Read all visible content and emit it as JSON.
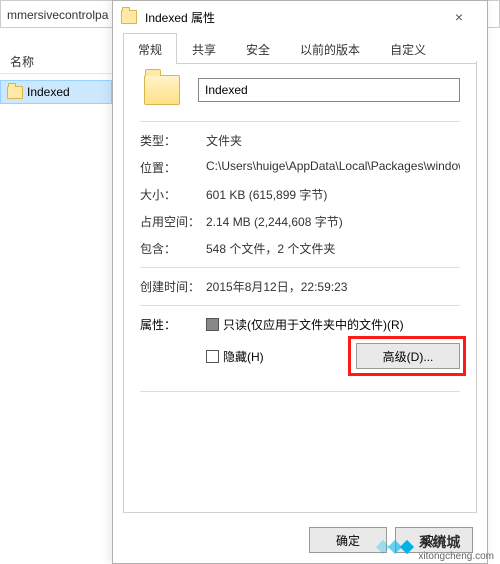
{
  "explorer": {
    "path": "mmersivecontrolpa",
    "column_name": "名称",
    "selected_item": "Indexed"
  },
  "dialog": {
    "title": "Indexed 属性",
    "close": "×",
    "tabs": [
      "常规",
      "共享",
      "安全",
      "以前的版本",
      "自定义"
    ],
    "name_value": "Indexed",
    "fields": {
      "type_label": "类型：",
      "type_value": "文件夹",
      "location_label": "位置：",
      "location_value": "C:\\Users\\huige\\AppData\\Local\\Packages\\window",
      "size_label": "大小：",
      "size_value": "601 KB (615,899 字节)",
      "disk_label": "占用空间：",
      "disk_value": "2.14 MB (2,244,608 字节)",
      "contains_label": "包含：",
      "contains_value": "548 个文件，2 个文件夹",
      "created_label": "创建时间：",
      "created_value": "2015年8月12日，22:59:23",
      "attr_label": "属性：",
      "readonly_label": "只读(仅应用于文件夹中的文件)(R)",
      "hidden_label": "隐藏(H)",
      "advanced_label": "高级(D)..."
    },
    "buttons": {
      "ok": "确定",
      "cancel": "取消"
    }
  },
  "watermark": {
    "brand": "系统城",
    "url": "xitongcheng.com"
  }
}
